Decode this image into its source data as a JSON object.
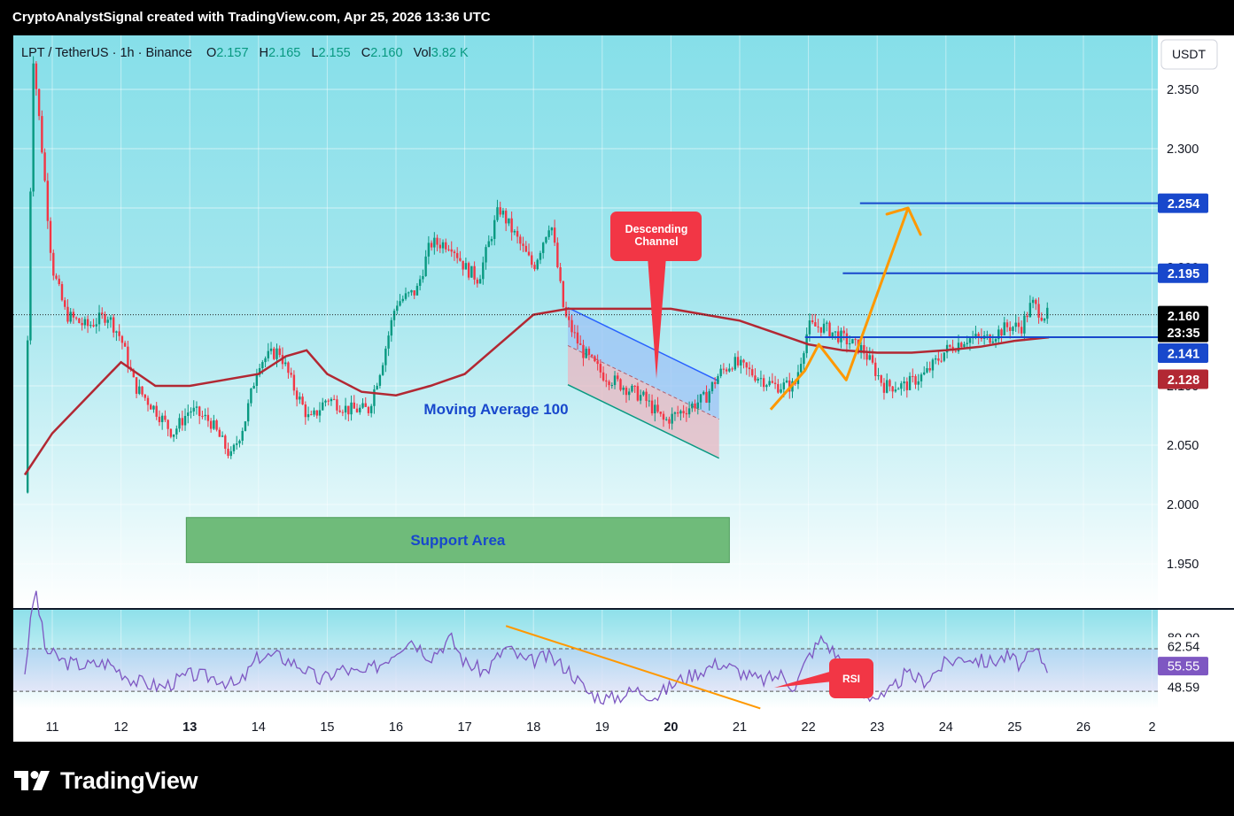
{
  "header": {
    "caption": "CryptoAnalystSignal created with TradingView.com, Apr 25, 2026 13:36 UTC"
  },
  "footer": {
    "logo_text": "TradingView"
  },
  "legend": {
    "symbol": "LPT / TetherUS · 1h · Binance",
    "o_label": "O",
    "o_value": "2.157",
    "h_label": "H",
    "h_value": "2.165",
    "l_label": "L",
    "l_value": "2.155",
    "c_label": "C",
    "c_value": "2.160",
    "vol_label": "Vol",
    "vol_value": "3.82 K"
  },
  "currency_button": "USDT",
  "annotations": {
    "descending_channel": "Descending Channel",
    "moving_average": "Moving Average 100",
    "support_area": "Support Area",
    "rsi": "RSI"
  },
  "colors": {
    "bull": "#089981",
    "bear": "#f23645",
    "ma": "#b22833",
    "rsi_line": "#7e57c2",
    "level_line": "#1848cc",
    "arrow": "#ff9800",
    "callout": "#f23645",
    "support_fill": "#6fbb7a",
    "panel_top": "#8fdfe8",
    "panel_bottom": "#ffffff"
  },
  "chart_data": {
    "type": "candlestick",
    "symbol": "LPT/USDT",
    "timeframe": "1h",
    "y_axis": {
      "ticks": [
        2.35,
        2.3,
        2.25,
        2.2,
        2.15,
        2.1,
        2.05,
        2.0,
        1.95
      ],
      "tick_labels": [
        "2.350",
        "2.300",
        "2.250",
        "2.200",
        "2.150",
        "2.100",
        "2.050",
        "2.000",
        "1.950"
      ],
      "range": [
        1.9,
        2.4
      ]
    },
    "x_axis": {
      "tick_labels": [
        "11",
        "12",
        "13",
        "14",
        "15",
        "16",
        "17",
        "18",
        "19",
        "20",
        "21",
        "22",
        "23",
        "24",
        "25",
        "26",
        "2"
      ]
    },
    "price_labels": [
      {
        "text": "2.254",
        "kind": "level"
      },
      {
        "text": "2.195",
        "kind": "level"
      },
      {
        "text": "2.160",
        "kind": "last"
      },
      {
        "text": "23:35",
        "kind": "countdown"
      },
      {
        "text": "2.141",
        "kind": "level"
      },
      {
        "text": "2.128",
        "kind": "ma"
      }
    ],
    "close_path": [
      [
        10.6,
        2.01
      ],
      [
        10.72,
        2.38
      ],
      [
        10.85,
        2.3
      ],
      [
        11.0,
        2.2
      ],
      [
        11.2,
        2.16
      ],
      [
        11.5,
        2.15
      ],
      [
        11.8,
        2.16
      ],
      [
        12.0,
        2.14
      ],
      [
        12.2,
        2.1
      ],
      [
        12.5,
        2.08
      ],
      [
        12.75,
        2.06
      ],
      [
        13.0,
        2.08
      ],
      [
        13.3,
        2.07
      ],
      [
        13.6,
        2.04
      ],
      [
        13.8,
        2.07
      ],
      [
        14.0,
        2.12
      ],
      [
        14.3,
        2.13
      ],
      [
        14.5,
        2.1
      ],
      [
        14.75,
        2.07
      ],
      [
        15.0,
        2.09
      ],
      [
        15.3,
        2.08
      ],
      [
        15.6,
        2.08
      ],
      [
        15.8,
        2.12
      ],
      [
        16.0,
        2.17
      ],
      [
        16.3,
        2.18
      ],
      [
        16.5,
        2.22
      ],
      [
        16.8,
        2.22
      ],
      [
        17.0,
        2.2
      ],
      [
        17.2,
        2.19
      ],
      [
        17.5,
        2.25
      ],
      [
        17.8,
        2.22
      ],
      [
        18.0,
        2.2
      ],
      [
        18.25,
        2.24
      ],
      [
        18.45,
        2.16
      ],
      [
        18.7,
        2.13
      ],
      [
        19.0,
        2.11
      ],
      [
        19.3,
        2.1
      ],
      [
        19.6,
        2.09
      ],
      [
        19.9,
        2.07
      ],
      [
        20.2,
        2.08
      ],
      [
        20.5,
        2.09
      ],
      [
        20.7,
        2.11
      ],
      [
        20.9,
        2.12
      ],
      [
        21.2,
        2.11
      ],
      [
        21.5,
        2.1
      ],
      [
        21.8,
        2.1
      ],
      [
        22.0,
        2.15
      ],
      [
        22.2,
        2.15
      ],
      [
        22.5,
        2.14
      ],
      [
        22.8,
        2.13
      ],
      [
        23.1,
        2.1
      ],
      [
        23.4,
        2.1
      ],
      [
        23.7,
        2.11
      ],
      [
        24.0,
        2.13
      ],
      [
        24.3,
        2.14
      ],
      [
        24.6,
        2.14
      ],
      [
        24.9,
        2.15
      ],
      [
        25.1,
        2.15
      ],
      [
        25.25,
        2.17
      ],
      [
        25.4,
        2.16
      ],
      [
        25.5,
        2.16
      ]
    ],
    "moving_average_100": [
      [
        10.6,
        2.025
      ],
      [
        11.0,
        2.06
      ],
      [
        11.5,
        2.09
      ],
      [
        12.0,
        2.12
      ],
      [
        12.5,
        2.1
      ],
      [
        13.0,
        2.1
      ],
      [
        13.5,
        2.105
      ],
      [
        14.0,
        2.11
      ],
      [
        14.4,
        2.125
      ],
      [
        14.7,
        2.13
      ],
      [
        15.0,
        2.11
      ],
      [
        15.5,
        2.095
      ],
      [
        16.0,
        2.092
      ],
      [
        16.5,
        2.1
      ],
      [
        17.0,
        2.11
      ],
      [
        17.5,
        2.135
      ],
      [
        18.0,
        2.16
      ],
      [
        18.5,
        2.165
      ],
      [
        19.0,
        2.165
      ],
      [
        19.5,
        2.165
      ],
      [
        20.0,
        2.165
      ],
      [
        20.5,
        2.16
      ],
      [
        21.0,
        2.155
      ],
      [
        21.5,
        2.145
      ],
      [
        22.0,
        2.135
      ],
      [
        22.5,
        2.13
      ],
      [
        23.0,
        2.128
      ],
      [
        23.5,
        2.128
      ],
      [
        24.0,
        2.13
      ],
      [
        24.5,
        2.133
      ],
      [
        25.0,
        2.138
      ],
      [
        25.5,
        2.141
      ]
    ],
    "horizontal_levels": [
      {
        "value": 2.254,
        "x_start": 22.75
      },
      {
        "value": 2.195,
        "x_start": 22.5
      },
      {
        "value": 2.141,
        "x_start": 21.95
      }
    ],
    "support_area": {
      "x_range": [
        12.95,
        20.85
      ],
      "y_range": [
        1.951,
        1.989
      ]
    },
    "descending_channel": {
      "upper": [
        [
          18.5,
          2.166
        ],
        [
          20.7,
          2.104
        ]
      ],
      "lower": [
        [
          18.5,
          2.101
        ],
        [
          20.7,
          2.039
        ]
      ],
      "mid": [
        [
          18.5,
          2.134
        ],
        [
          20.7,
          2.072
        ]
      ]
    },
    "projection_arrow": [
      [
        21.45,
        2.08
      ],
      [
        21.95,
        2.113
      ],
      [
        22.15,
        2.135
      ],
      [
        22.55,
        2.105
      ],
      [
        23.45,
        2.25
      ]
    ],
    "rsi": {
      "range": [
        30,
        85
      ],
      "levels": [
        62.54,
        48.59
      ],
      "current": 55.55,
      "tick_labels": [
        "80.00",
        "62.54",
        "55.55",
        "48.59"
      ],
      "trendline": [
        [
          17.6,
          70
        ],
        [
          21.3,
          43
        ]
      ],
      "path": [
        [
          10.6,
          55
        ],
        [
          10.75,
          83
        ],
        [
          10.9,
          62
        ],
        [
          11.2,
          58
        ],
        [
          11.5,
          57
        ],
        [
          11.8,
          58
        ],
        [
          12.2,
          52
        ],
        [
          12.6,
          50
        ],
        [
          13.0,
          54
        ],
        [
          13.4,
          53
        ],
        [
          13.7,
          50
        ],
        [
          14.0,
          60
        ],
        [
          14.3,
          60
        ],
        [
          14.6,
          57
        ],
        [
          14.9,
          52
        ],
        [
          15.2,
          56
        ],
        [
          15.5,
          54
        ],
        [
          15.8,
          58
        ],
        [
          16.2,
          66
        ],
        [
          16.5,
          60
        ],
        [
          16.8,
          66
        ],
        [
          17.0,
          58
        ],
        [
          17.3,
          55
        ],
        [
          17.6,
          63
        ],
        [
          17.9,
          58
        ],
        [
          18.2,
          60
        ],
        [
          18.5,
          56
        ],
        [
          18.8,
          48
        ],
        [
          19.1,
          46
        ],
        [
          19.5,
          49
        ],
        [
          19.8,
          47
        ],
        [
          20.1,
          52
        ],
        [
          20.4,
          55
        ],
        [
          20.7,
          58
        ],
        [
          21.0,
          55
        ],
        [
          21.3,
          52
        ],
        [
          21.6,
          54
        ],
        [
          21.8,
          50
        ],
        [
          22.0,
          60
        ],
        [
          22.2,
          66
        ],
        [
          22.5,
          58
        ],
        [
          22.8,
          48
        ],
        [
          23.1,
          46
        ],
        [
          23.4,
          54
        ],
        [
          23.7,
          52
        ],
        [
          24.0,
          58
        ],
        [
          24.3,
          60
        ],
        [
          24.6,
          58
        ],
        [
          24.9,
          60
        ],
        [
          25.1,
          57
        ],
        [
          25.3,
          62
        ],
        [
          25.5,
          55.55
        ]
      ]
    }
  }
}
